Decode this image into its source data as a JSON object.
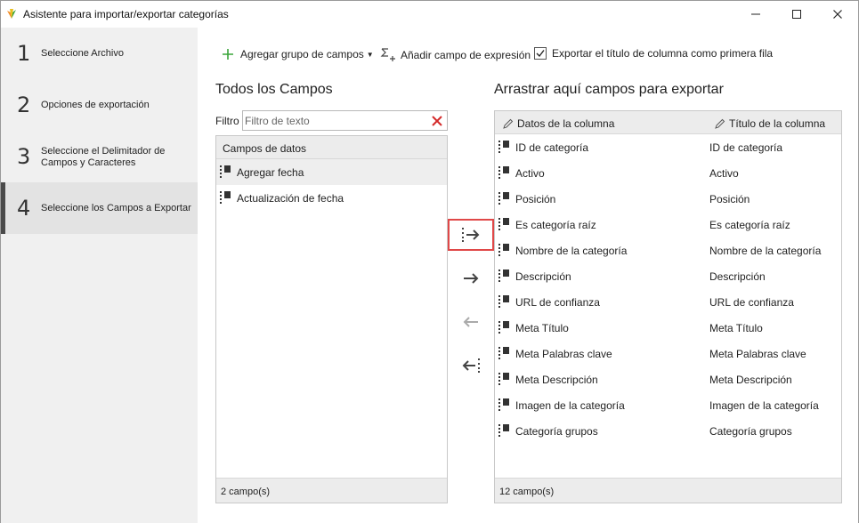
{
  "window": {
    "title": "Asistente para importar/exportar categorías"
  },
  "sidebar": {
    "steps": [
      {
        "number": "1",
        "label": "Seleccione Archivo"
      },
      {
        "number": "2",
        "label": "Opciones de exportación"
      },
      {
        "number": "3",
        "label_line1": "Seleccione el Delimitador de",
        "label_line2": "Campos y Caracteres"
      },
      {
        "number": "4",
        "label": "Seleccione los Campos a Exportar"
      }
    ],
    "active_step": 4
  },
  "toolbar": {
    "add_group_label": "Agregar grupo de campos",
    "add_expression_label": "Añadir campo de expresión",
    "export_header_label": "Exportar el título de columna como primera fila",
    "export_header_checked": true
  },
  "left_panel": {
    "title": "Todos los Campos",
    "filter_label": "Filtro",
    "filter_placeholder": "Filtro de texto",
    "filter_value": "",
    "header": "Campos de datos",
    "items": [
      "Agregar fecha",
      "Actualización de fecha"
    ],
    "selected_index": 0,
    "footer": "2 campo(s)"
  },
  "right_panel": {
    "title": "Arrastrar aquí campos para exportar",
    "col_data": "Datos de la columna",
    "col_title": "Título de la columna",
    "rows": [
      {
        "data": "ID de categoría",
        "title": "ID de categoría"
      },
      {
        "data": "Activo",
        "title": "Activo"
      },
      {
        "data": "Posición",
        "title": "Posición"
      },
      {
        "data": "Es categoría raíz",
        "title": "Es categoría raíz"
      },
      {
        "data": "Nombre de la categoría",
        "title": "Nombre de la categoría"
      },
      {
        "data": "Descripción",
        "title": "Descripción"
      },
      {
        "data": "URL de confianza",
        "title": "URL de confianza"
      },
      {
        "data": "Meta Título",
        "title": "Meta Título"
      },
      {
        "data": "Meta Palabras clave",
        "title": "Meta Palabras clave"
      },
      {
        "data": "Meta Descripción",
        "title": "Meta Descripción"
      },
      {
        "data": "Imagen de la categoría",
        "title": "Imagen de la categoría"
      },
      {
        "data": "Categoría grupos",
        "title": "Categoría grupos"
      }
    ],
    "footer": "12 campo(s)"
  },
  "move_buttons": [
    {
      "icon": "move-all-right-icon",
      "highlighted": true
    },
    {
      "icon": "move-right-icon",
      "highlighted": false
    },
    {
      "icon": "move-left-icon",
      "highlighted": false,
      "disabled": true
    },
    {
      "icon": "move-all-left-icon",
      "highlighted": false
    }
  ],
  "colors": {
    "accent_add": "#3aa53a",
    "highlight": "#e04848",
    "clear": "#d42a2a"
  }
}
